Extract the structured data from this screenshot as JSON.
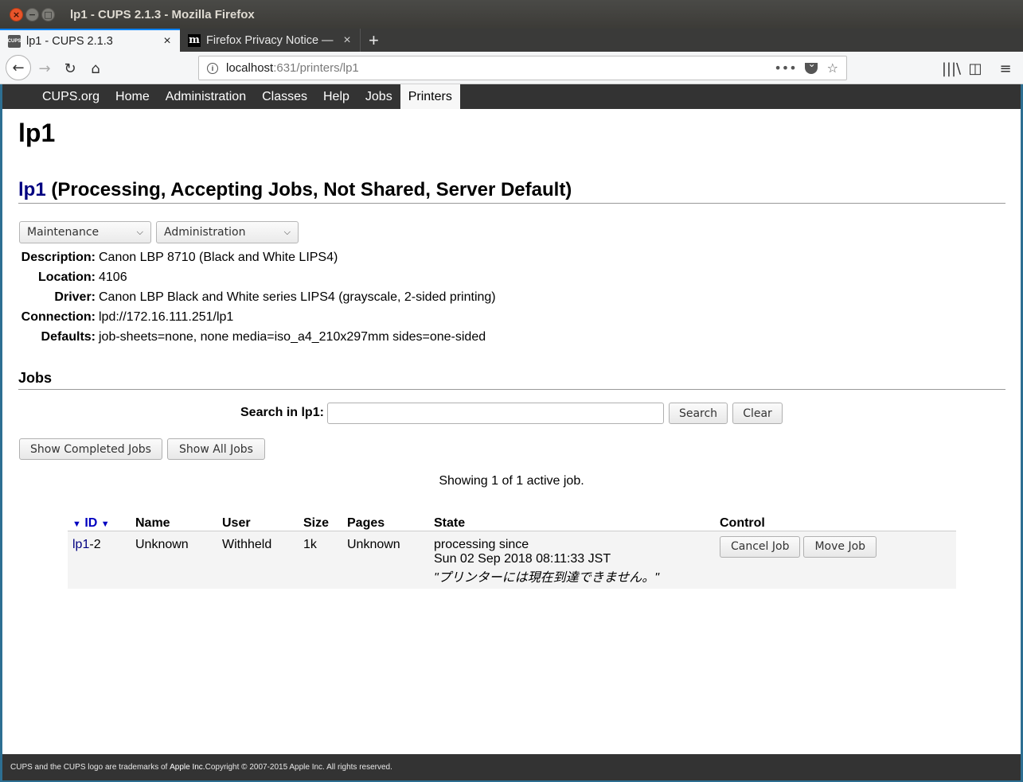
{
  "window": {
    "title": "lp1 - CUPS 2.1.3 - Mozilla Firefox"
  },
  "tabs": [
    {
      "label": "lp1 - CUPS 2.1.3",
      "active": true
    },
    {
      "label": "Firefox Privacy Notice —",
      "active": false
    }
  ],
  "url": {
    "host": "localhost",
    "rest": ":631/printers/lp1"
  },
  "icons": {
    "close": "×",
    "min": "−",
    "max": "□",
    "plus": "+",
    "back": "←",
    "forward": "→",
    "reload": "↻",
    "home": "⌂",
    "info": "i",
    "more": "•••",
    "star": "☆",
    "library": "|||\\",
    "sidebar": "◫",
    "menu": "≡",
    "chevron": "⌄",
    "sort": "▼",
    "cups_favicon": "CUPS",
    "moz_favicon": "m"
  },
  "cups_nav": [
    "CUPS.org",
    "Home",
    "Administration",
    "Classes",
    "Help",
    "Jobs",
    "Printers"
  ],
  "cups_nav_selected": "Printers",
  "page": {
    "title": "lp1",
    "heading_link": "lp1",
    "heading_status": " (Processing, Accepting Jobs, Not Shared, Server Default)",
    "maintenance_select": "Maintenance",
    "administration_select": "Administration",
    "properties": [
      {
        "key": "Description:",
        "value": "Canon LBP 8710 (Black and White LIPS4)"
      },
      {
        "key": "Location:",
        "value": "4106"
      },
      {
        "key": "Driver:",
        "value": "Canon LBP Black and White series LIPS4 (grayscale, 2-sided printing)"
      },
      {
        "key": "Connection:",
        "value": "lpd://172.16.111.251/lp1"
      },
      {
        "key": "Defaults:",
        "value": "job-sheets=none, none media=iso_a4_210x297mm sides=one-sided"
      }
    ],
    "jobs_heading": "Jobs",
    "search_label": "Search in lp1:",
    "search_value": "",
    "search_button": "Search",
    "clear_button": "Clear",
    "show_completed_button": "Show Completed Jobs",
    "show_all_button": "Show All Jobs",
    "showing_text": "Showing 1 of 1 active job.",
    "table": {
      "headers": {
        "id": "ID",
        "name": "Name",
        "user": "User",
        "size": "Size",
        "pages": "Pages",
        "state": "State",
        "control": "Control"
      },
      "rows": [
        {
          "id_link": "lp1",
          "id_suffix": "-2",
          "name": "Unknown",
          "user": "Withheld",
          "size": "1k",
          "pages": "Unknown",
          "state_line1": "processing since",
          "state_line2": "Sun 02 Sep 2018 08:11:33 JST",
          "state_msg": "\"プリンターには現在到達できません。\"",
          "cancel_button": "Cancel Job",
          "move_button": "Move Job"
        }
      ]
    }
  },
  "footer": {
    "part1": "CUPS and the CUPS logo are trademarks of ",
    "apple": "Apple Inc.",
    "part2": " Copyright © 2007-2015 Apple Inc. All rights reserved."
  },
  "colors": {
    "cups_nav_bg": "#333333",
    "link": "#000080",
    "tab_accent": "#0a84ff"
  }
}
